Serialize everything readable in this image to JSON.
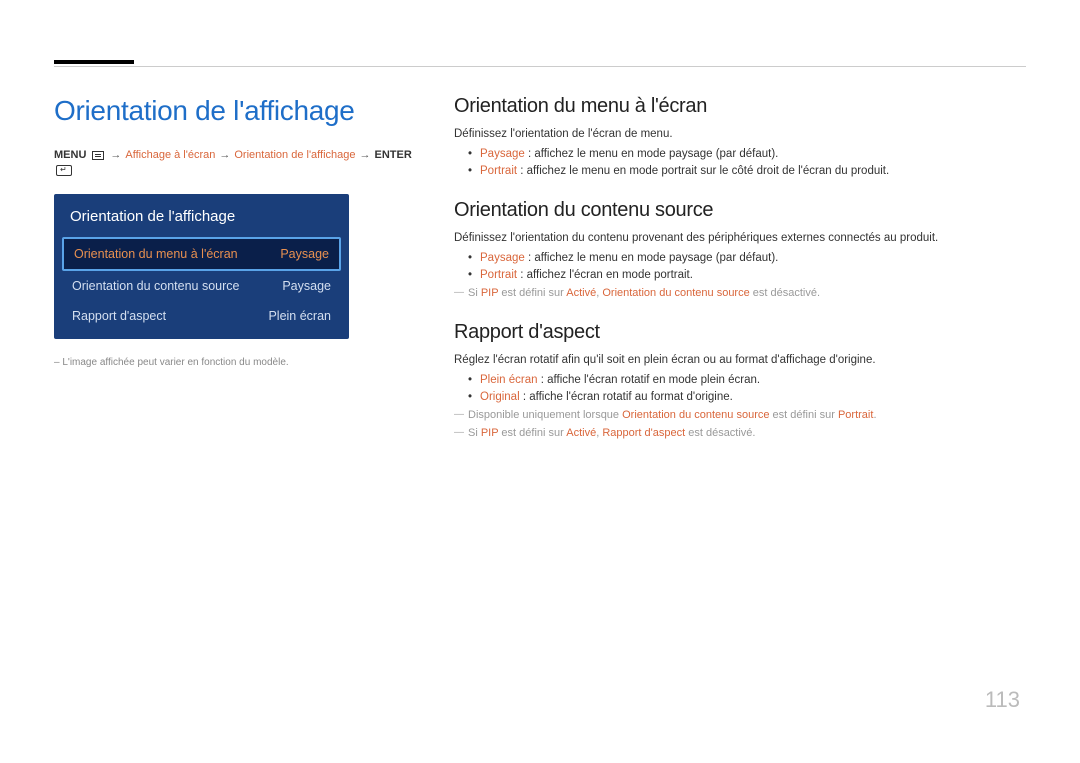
{
  "main_title": "Orientation de l'affichage",
  "breadcrumb": {
    "menu": "MENU",
    "part1": "Affichage à l'écran",
    "part2": "Orientation de l'affichage",
    "enter": "ENTER"
  },
  "panel": {
    "title": "Orientation de l'affichage",
    "rows": [
      {
        "label": "Orientation du menu à l'écran",
        "value": "Paysage"
      },
      {
        "label": "Orientation du contenu source",
        "value": "Paysage"
      },
      {
        "label": "Rapport d'aspect",
        "value": "Plein écran"
      }
    ]
  },
  "footnote": "L'image affichée peut varier en fonction du modèle.",
  "sections": {
    "s1": {
      "title": "Orientation du menu à l'écran",
      "desc": "Définissez l'orientation de l'écran de menu.",
      "b1_key": "Paysage",
      "b1_rest": " : affichez le menu en mode paysage (par défaut).",
      "b2_key": "Portrait",
      "b2_rest": " : affichez le menu en mode portrait sur le côté droit de l'écran du produit."
    },
    "s2": {
      "title": "Orientation du contenu source",
      "desc": "Définissez l'orientation du contenu provenant des périphériques externes connectés au produit.",
      "b1_key": "Paysage",
      "b1_rest": " : affichez le menu en mode paysage (par défaut).",
      "b2_key": "Portrait",
      "b2_rest": " : affichez l'écran en mode portrait.",
      "note_pre": "Si ",
      "note_pip": "PIP",
      "note_mid1": " est défini sur ",
      "note_active": "Activé",
      "note_mid2": ", ",
      "note_item": "Orientation du contenu source",
      "note_post": " est désactivé."
    },
    "s3": {
      "title": "Rapport d'aspect",
      "desc": "Réglez l'écran rotatif afin qu'il soit en plein écran ou au format d'affichage d'origine.",
      "b1_key": "Plein écran",
      "b1_rest": " : affiche l'écran rotatif en mode plein écran.",
      "b2_key": "Original",
      "b2_rest": " : affiche l'écran rotatif au format d'origine.",
      "note1_pre": "Disponible uniquement lorsque ",
      "note1_item": "Orientation du contenu source",
      "note1_mid": " est défini sur ",
      "note1_val": "Portrait",
      "note1_post": ".",
      "note2_pre": "Si ",
      "note2_pip": "PIP",
      "note2_mid1": " est défini sur ",
      "note2_active": "Activé",
      "note2_mid2": ", ",
      "note2_item": "Rapport d'aspect",
      "note2_post": " est désactivé."
    }
  },
  "page_number": "113"
}
